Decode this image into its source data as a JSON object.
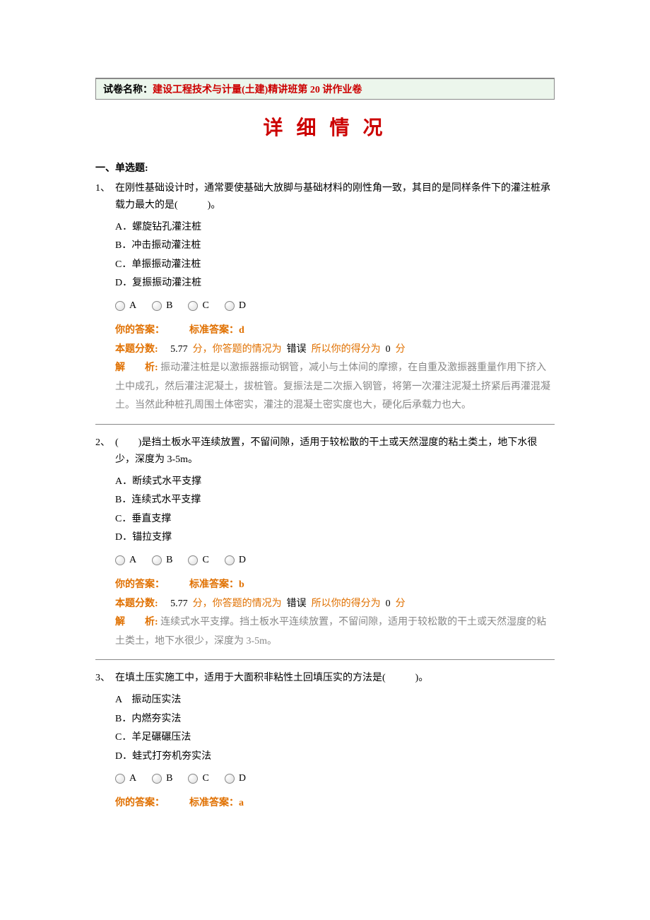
{
  "header": {
    "prefix": "试卷名称：",
    "title": "建设工程技术与计量(土建)精讲班第 20 讲作业卷"
  },
  "page_title": "详 细 情 况",
  "section_label": "一、单选题:",
  "radio_labels": [
    "A",
    "B",
    "C",
    "D"
  ],
  "questions": [
    {
      "num": "1、",
      "stem": "在刚性基础设计时，通常要使基础大放脚与基础材料的刚性角一致，其目的是同样条件下的灌注桩承载力最大的是(　　　)。",
      "options": [
        "A．螺旋钻孔灌注桩",
        "B．冲击振动灌注桩",
        "C．单振振动灌注桩",
        "D．复振振动灌注桩"
      ],
      "your_ans_label": "你的答案：",
      "std_ans_label": "标准答案：",
      "std_ans": "d",
      "score_label": "本题分数:",
      "score_line_1": "5.77",
      "score_line_2": "分，你答题的情况为",
      "score_status": "错误",
      "score_line_3": "所以你的得分为",
      "score_got": "0",
      "score_unit": "分",
      "analysis_label": "解　　析:",
      "analysis": "振动灌注桩是以激振器振动钢管，减小与土体间的摩擦，在自重及激振器重量作用下挤入土中成孔，然后灌注泥凝土，拔桩管。复振法是二次振入钢管，将第一次灌注泥凝土挤紧后再灌混凝土。当然此种桩孔周围土体密实，灌注的混凝土密实度也大，硬化后承载力也大。"
    },
    {
      "num": "2、",
      "stem": "(　　)是挡土板水平连续放置，不留间隙，适用于较松散的干土或天然湿度的粘土类土，地下水很少，深度为 3-5m。",
      "options": [
        "A．断续式水平支撑",
        "B．连续式水平支撑",
        "C．垂直支撑",
        "D．锚拉支撑"
      ],
      "your_ans_label": "你的答案：",
      "std_ans_label": "标准答案：",
      "std_ans": "b",
      "score_label": "本题分数:",
      "score_line_1": "5.77",
      "score_line_2": "分，你答题的情况为",
      "score_status": "错误",
      "score_line_3": "所以你的得分为",
      "score_got": "0",
      "score_unit": "分",
      "analysis_label": "解　　析:",
      "analysis": "连续式水平支撑。挡土板水平连续放置，不留间隙，适用于较松散的干土或天然湿度的粘土类土，地下水很少，深度为 3-5m。"
    },
    {
      "num": "3、",
      "stem": "在填土压实施工中，适用于大面积非粘性土回填压实的方法是(　　　)。",
      "options": [
        "A　振动压实法",
        "B．内燃夯实法",
        "C．羊足碾碾压法",
        "D．蛙式打夯机夯实法"
      ],
      "your_ans_label": "你的答案：",
      "std_ans_label": "标准答案：",
      "std_ans": "a"
    }
  ]
}
